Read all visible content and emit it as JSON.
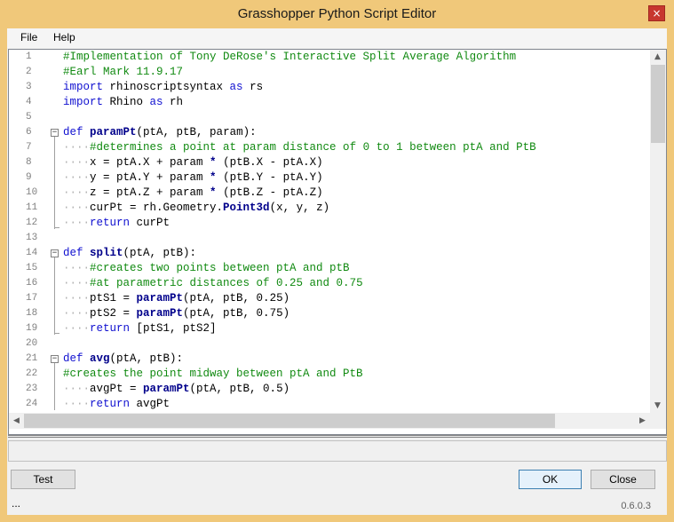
{
  "window": {
    "title": "Grasshopper Python Script Editor",
    "close_glyph": "×"
  },
  "menu": {
    "file": "File",
    "help": "Help"
  },
  "editor": {
    "lines": [
      {
        "n": "1",
        "html": "<span class=\"cm\">#Implementation of Tony DeRose's Interactive Split Average Algorithm</span>"
      },
      {
        "n": "2",
        "html": "<span class=\"cm\">#Earl Mark 11.9.17</span>"
      },
      {
        "n": "3",
        "html": "<span class=\"kw\">import</span> rhinoscriptsyntax <span class=\"kw\">as</span> rs"
      },
      {
        "n": "4",
        "html": "<span class=\"kw\">import</span> Rhino <span class=\"kw\">as</span> rh"
      },
      {
        "n": "5",
        "html": ""
      },
      {
        "n": "6",
        "html": "<span class=\"kw\">def</span> <span class=\"fn\">paramPt</span>(ptA, ptB, param):"
      },
      {
        "n": "7",
        "html": "<span class=\"dot\">····</span><span class=\"cm\">#determines a point at param distance of 0 to 1 between ptA and PtB</span>"
      },
      {
        "n": "8",
        "html": "<span class=\"dot\">····</span>x = ptA.X + param <span class=\"fn\">*</span> (ptB.X - ptA.X)"
      },
      {
        "n": "9",
        "html": "<span class=\"dot\">····</span>y = ptA.Y + param <span class=\"fn\">*</span> (ptB.Y - ptA.Y)"
      },
      {
        "n": "10",
        "html": "<span class=\"dot\">····</span>z = ptA.Z + param <span class=\"fn\">*</span> (ptB.Z - ptA.Z)"
      },
      {
        "n": "11",
        "html": "<span class=\"dot\">····</span>curPt = rh.Geometry.<span class=\"fn\">Point3d</span>(x, y, z)"
      },
      {
        "n": "12",
        "html": "<span class=\"dot\">····</span><span class=\"kw\">return</span> curPt"
      },
      {
        "n": "13",
        "html": ""
      },
      {
        "n": "14",
        "html": "<span class=\"kw\">def</span> <span class=\"fn\">split</span>(ptA, ptB):"
      },
      {
        "n": "15",
        "html": "<span class=\"dot\">····</span><span class=\"cm\">#creates two points between ptA and ptB</span>"
      },
      {
        "n": "16",
        "html": "<span class=\"dot\">····</span><span class=\"cm\">#at parametric distances of 0.25 and 0.75</span>"
      },
      {
        "n": "17",
        "html": "<span class=\"dot\">····</span>ptS1 = <span class=\"fn\">paramPt</span>(ptA, ptB, 0.25)"
      },
      {
        "n": "18",
        "html": "<span class=\"dot\">····</span>ptS2 = <span class=\"fn\">paramPt</span>(ptA, ptB, 0.75)"
      },
      {
        "n": "19",
        "html": "<span class=\"dot\">····</span><span class=\"kw\">return</span> [ptS1, ptS2]"
      },
      {
        "n": "20",
        "html": ""
      },
      {
        "n": "21",
        "html": "<span class=\"kw\">def</span> <span class=\"fn\">avg</span>(ptA, ptB):"
      },
      {
        "n": "22",
        "html": "<span class=\"cm\">#creates the point midway between ptA and PtB</span>"
      },
      {
        "n": "23",
        "html": "<span class=\"dot\">····</span>avgPt = <span class=\"fn\">paramPt</span>(ptA, ptB, 0.5)"
      },
      {
        "n": "24",
        "html": "<span class=\"dot\">····</span><span class=\"kw\">return</span> avgPt"
      }
    ]
  },
  "buttons": {
    "test": "Test",
    "ok": "OK",
    "close": "Close"
  },
  "status": {
    "left": "...",
    "version": "0.6.0.3"
  }
}
